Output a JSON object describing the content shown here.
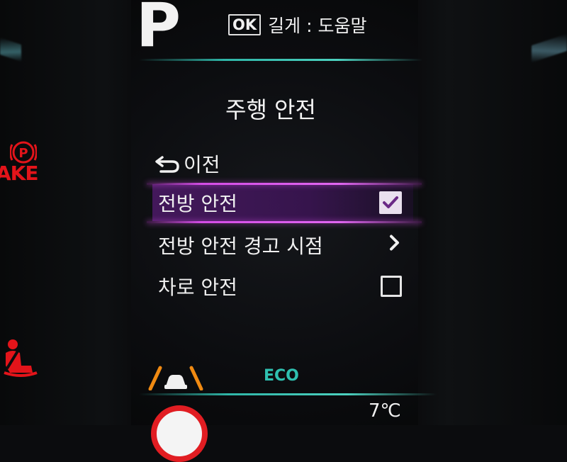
{
  "gear": {
    "position": "P"
  },
  "hint": {
    "ok_key": "OK",
    "text": "길게 : 도움말"
  },
  "menu": {
    "title": "주행 안전",
    "back_label": "이전",
    "items": [
      {
        "label": "전방 안전",
        "control": "checkbox",
        "checked": true,
        "selected": true
      },
      {
        "label": "전방 안전 경고 시점",
        "control": "submenu-chevron",
        "selected": false
      },
      {
        "label": "차로 안전",
        "control": "checkbox",
        "checked": false,
        "selected": false
      }
    ]
  },
  "warnings": {
    "brake_text": "AKE",
    "brake_icon": "parking-brake-icon",
    "seatbelt_icon": "seatbelt-warning-icon"
  },
  "status": {
    "eco_label": "ECO",
    "lane_icon": "lane-assist-icon",
    "temperature": "7℃"
  },
  "colors": {
    "accent_teal": "#2fb6a8",
    "selection_magenta": "#d44de6",
    "selection_bg": "#46195f",
    "warning_red": "#e3141a",
    "lane_orange": "#f08a12"
  }
}
